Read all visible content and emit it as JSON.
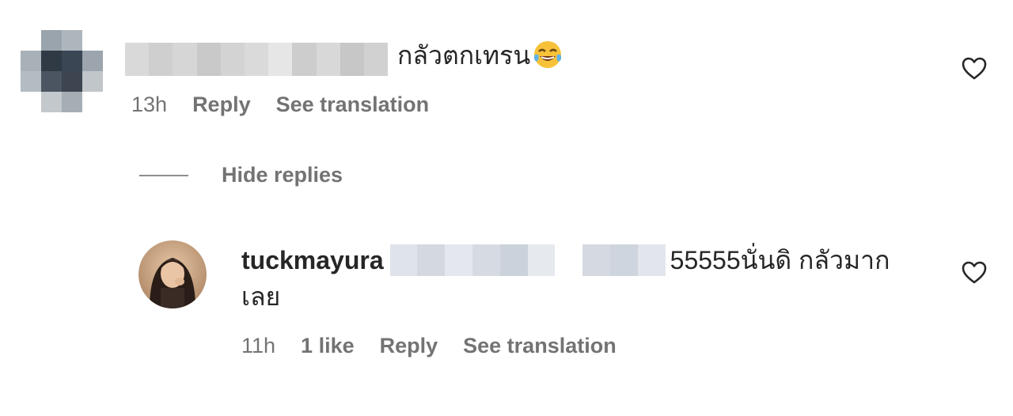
{
  "comment": {
    "text": "กลัวตกเทรน",
    "emoji": "face-with-tears-of-joy",
    "time": "13h",
    "reply_label": "Reply",
    "translate_label": "See translation"
  },
  "thread": {
    "hide_replies_label": "Hide replies"
  },
  "reply": {
    "username": "tuckmayura",
    "text": "55555นั่นดิ กลัวมากเลย",
    "time": "11h",
    "likes_label": "1 like",
    "reply_label": "Reply",
    "translate_label": "See translation"
  },
  "colors": {
    "text_primary": "#262626",
    "text_secondary": "#737373",
    "background": "#ffffff"
  },
  "icons": [
    "heart-icon",
    "face-with-tears-of-joy-emoji"
  ]
}
